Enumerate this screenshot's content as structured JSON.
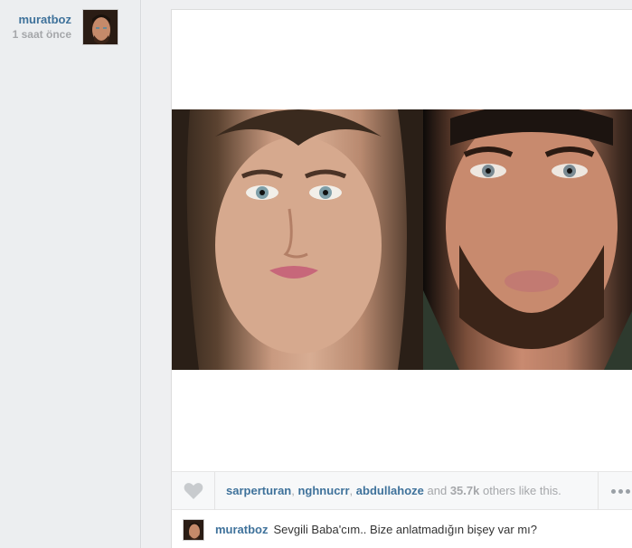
{
  "author": {
    "username": "muratboz",
    "time": "1 saat önce"
  },
  "post": {
    "photo_icon": "photo-image",
    "likes": {
      "likers": [
        "sarperturan",
        "nghnucrr",
        "abdullahoze"
      ],
      "sep1": ", ",
      "sep2": ", ",
      "and_text": " and ",
      "count": "35.7k",
      "suffix": " others like this."
    },
    "like_icon": "heart-icon",
    "more_icon": "more-icon",
    "caption": {
      "username": "muratboz",
      "text": "Sevgili Baba'cım.. Bize anlatmadığın bişey var mı?"
    }
  },
  "colors": {
    "link": "#3f729b",
    "muted": "#a5a7aa",
    "background": "#eeeff1"
  }
}
